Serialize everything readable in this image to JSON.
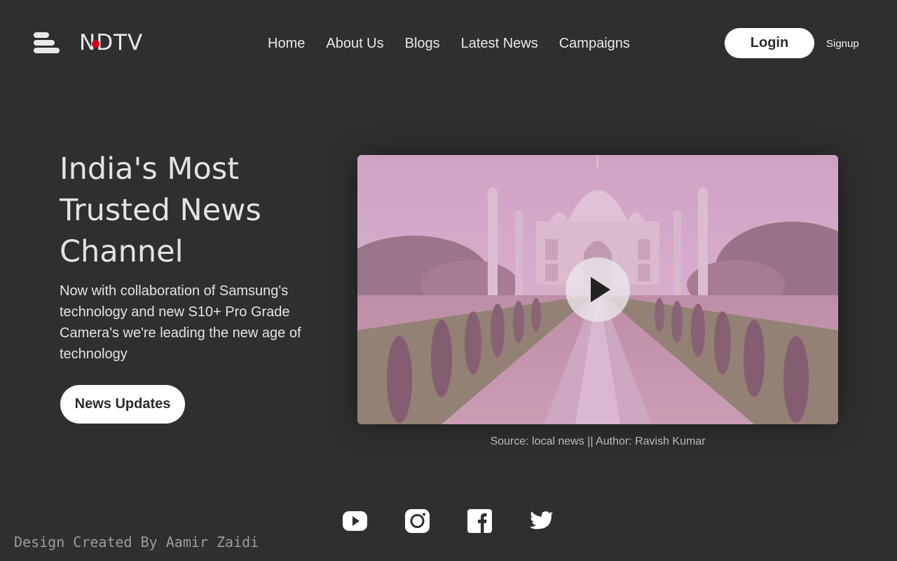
{
  "header": {
    "logo_text": "NDTV",
    "nav": [
      "Home",
      "About Us",
      "Blogs",
      "Latest News",
      "Campaigns"
    ],
    "login_label": "Login",
    "signup_label": "Signup"
  },
  "hero": {
    "title": "India's Most Trusted News Channel",
    "description": "Now with collaboration of Samsung's technology and new S10+ Pro Grade Camera's we're leading the new age of technology",
    "cta_label": "News Updates"
  },
  "video": {
    "caption": "Source: local news || Author: Ravish Kumar"
  },
  "social": {
    "icons": [
      "youtube-icon",
      "instagram-icon",
      "facebook-icon",
      "twitter-icon"
    ]
  },
  "footer": {
    "credit": "Design Created By Aamir Zaidi"
  },
  "colors": {
    "background": "#2f2f2f",
    "logo_dot": "#d0021b",
    "button_bg": "#ffffff",
    "video_tint": "#e8a0c8"
  }
}
